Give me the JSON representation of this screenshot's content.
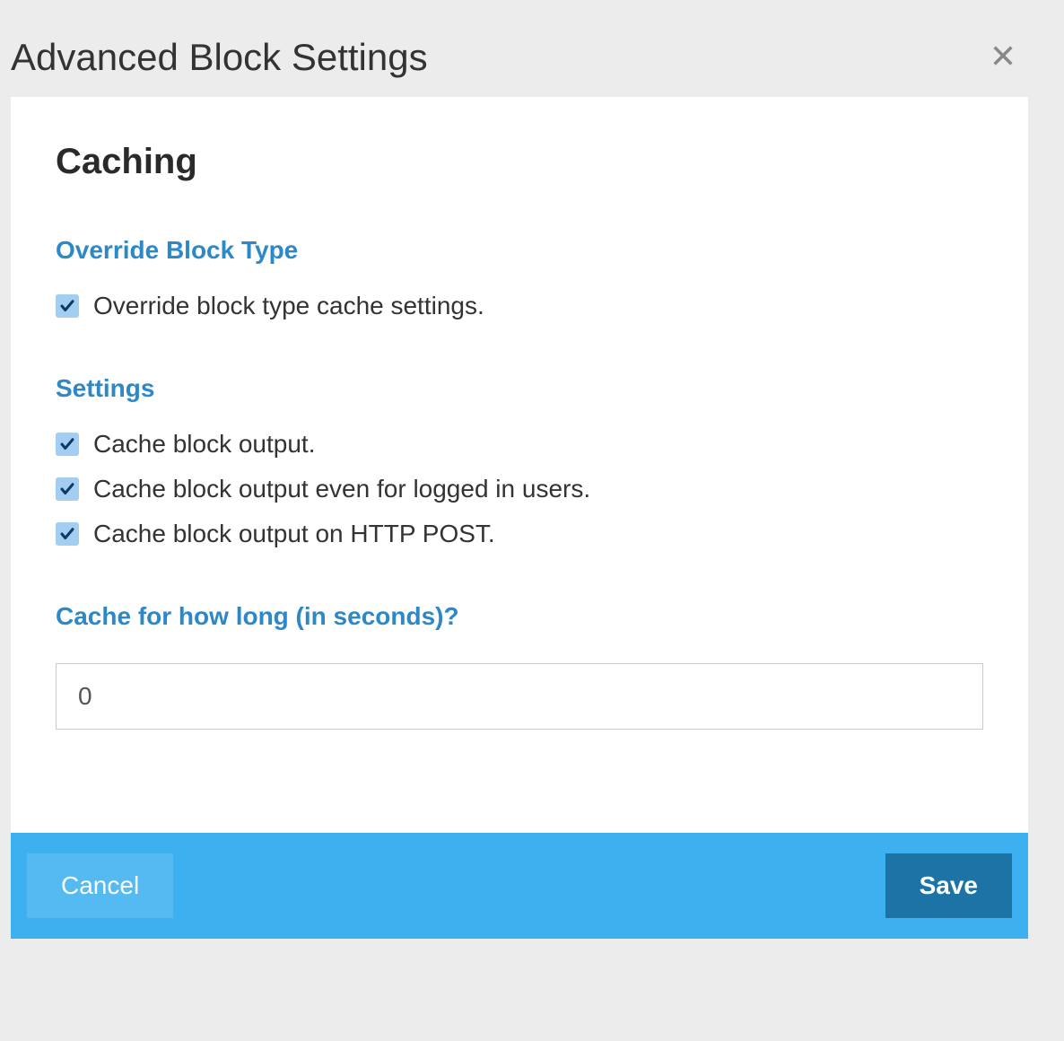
{
  "dialog": {
    "title": "Advanced Block Settings"
  },
  "panel": {
    "main_title": "Caching",
    "section_override": {
      "title": "Override Block Type",
      "checkbox_label": "Override block type cache settings."
    },
    "section_settings": {
      "title": "Settings",
      "checkboxes": [
        "Cache block output.",
        "Cache block output even for logged in users.",
        "Cache block output on HTTP POST."
      ]
    },
    "section_duration": {
      "title": "Cache for how long (in seconds)?",
      "value": "0"
    }
  },
  "footer": {
    "cancel_label": "Cancel",
    "save_label": "Save"
  }
}
